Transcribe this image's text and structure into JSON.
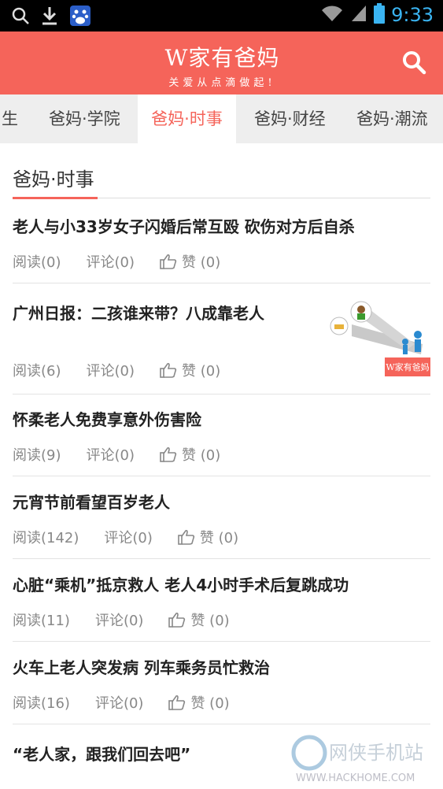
{
  "status_bar": {
    "time": "9:33"
  },
  "header": {
    "logo_main": "W家有爸妈",
    "logo_sub": "关爱从点滴做起!"
  },
  "tabs": [
    {
      "label": "生"
    },
    {
      "label": "爸妈·学院"
    },
    {
      "label": "爸妈·时事",
      "active": true
    },
    {
      "label": "爸妈·财经"
    },
    {
      "label": "爸妈·潮流"
    }
  ],
  "section_title": "爸妈·时事",
  "articles": [
    {
      "title": "老人与小33岁女子闪婚后常互殴 砍伤对方后自杀",
      "reads": "阅读(0)",
      "comments": "评论(0)",
      "like": "赞 (0)"
    },
    {
      "title": "广州日报：二孩谁来带？八成靠老人",
      "reads": "阅读(6)",
      "comments": "评论(0)",
      "like": "赞 (0)",
      "thumb_text": "W家有爸妈"
    },
    {
      "title": "怀柔老人免费享意外伤害险",
      "reads": "阅读(9)",
      "comments": "评论(0)",
      "like": "赞 (0)"
    },
    {
      "title": "元宵节前看望百岁老人",
      "reads": "阅读(142)",
      "comments": "评论(0)",
      "like": "赞 (0)"
    },
    {
      "title": "心脏“乘机”抵京救人 老人4小时手术后复跳成功",
      "reads": "阅读(11)",
      "comments": "评论(0)",
      "like": "赞 (0)"
    },
    {
      "title": "火车上老人突发病 列车乘务员忙救治",
      "reads": "阅读(16)",
      "comments": "评论(0)",
      "like": "赞 (0)"
    },
    {
      "title": "“老人家，跟我们回去吧”"
    }
  ],
  "watermark": {
    "line1": "网侠手机站",
    "line2": "WWW.HACKHOME.COM"
  }
}
